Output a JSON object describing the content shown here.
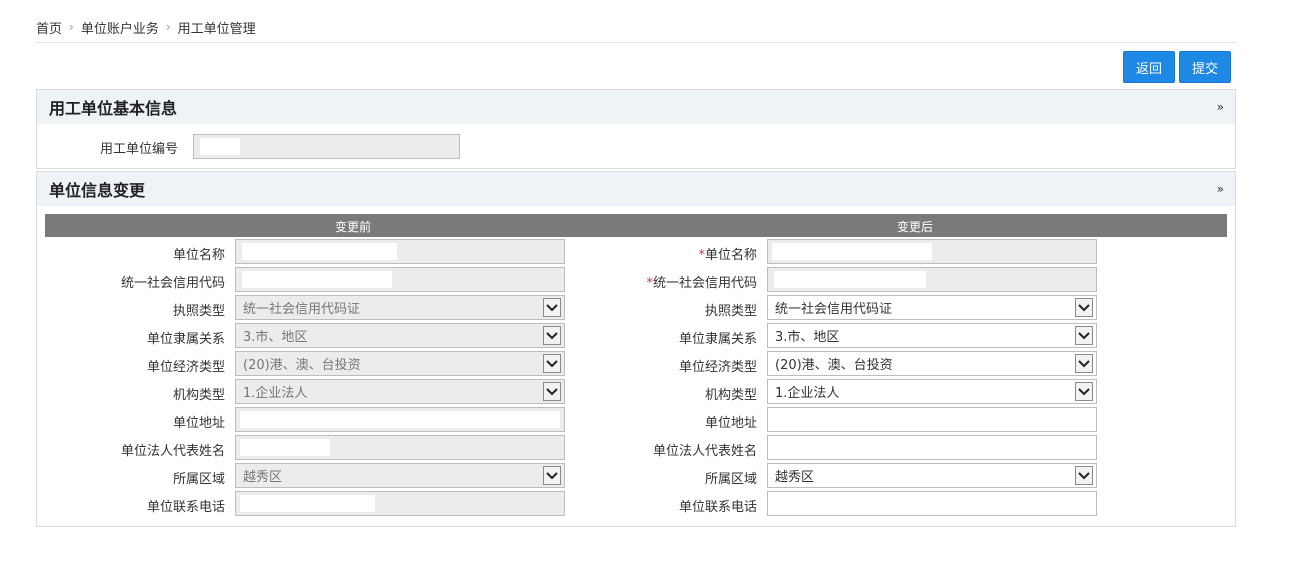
{
  "breadcrumb": {
    "home": "首页",
    "level1": "单位账户业务",
    "level2": "用工单位管理",
    "separator": "›"
  },
  "toolbar": {
    "back_label": "返回",
    "submit_label": "提交",
    "accent_color": "#1e88e5"
  },
  "basic_panel": {
    "title": "用工单位基本信息",
    "collapse_icon": "double-chevron-down-icon",
    "unit_code_label": "用工单位编号",
    "unit_code_value": ""
  },
  "change_panel": {
    "title": "单位信息变更",
    "before_header": "变更前",
    "after_header": "变更后",
    "required_mark": "*",
    "rows": [
      {
        "label": "单位名称",
        "required_after": true,
        "type": "text",
        "before": "",
        "after": ""
      },
      {
        "label": "统一社会信用代码",
        "required_after": true,
        "type": "text",
        "before": "",
        "after": ""
      },
      {
        "label": "执照类型",
        "type": "select",
        "before": "统一社会信用代码证",
        "after": "统一社会信用代码证"
      },
      {
        "label": "单位隶属关系",
        "type": "select",
        "before": "3.市、地区",
        "after": "3.市、地区"
      },
      {
        "label": "单位经济类型",
        "type": "select",
        "before": "(20)港、澳、台投资",
        "after": "(20)港、澳、台投资"
      },
      {
        "label": "机构类型",
        "type": "select",
        "before": "1.企业法人",
        "after": "1.企业法人"
      },
      {
        "label": "单位地址",
        "type": "text",
        "before": "",
        "after": ""
      },
      {
        "label": "单位法人代表姓名",
        "type": "text",
        "before": "",
        "after": ""
      },
      {
        "label": "所属区域",
        "type": "select",
        "before": "越秀区",
        "after": "越秀区"
      },
      {
        "label": "单位联系电话",
        "type": "text",
        "before": "",
        "after": ""
      }
    ]
  }
}
